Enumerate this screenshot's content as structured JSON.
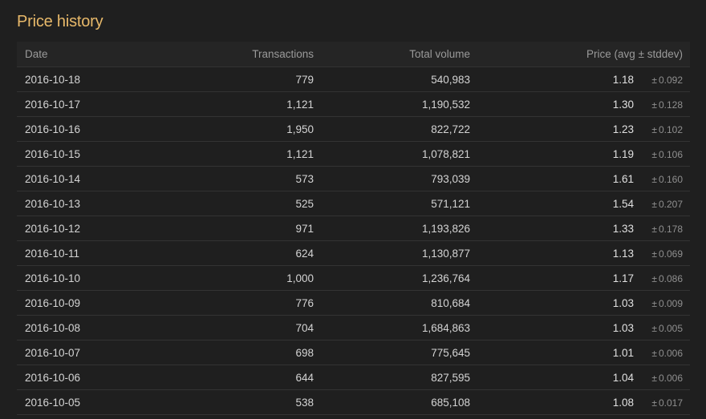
{
  "title": "Price history",
  "columns": {
    "date": "Date",
    "transactions": "Transactions",
    "volume": "Total volume",
    "price": "Price (avg ± stddev)"
  },
  "pm_symbol": "±",
  "colors": {
    "background": "#1f1f1f",
    "title": "#e8b96a",
    "header_text": "#9a9a9a",
    "row_divider": "#333333"
  },
  "rows": [
    {
      "date": "2016-10-18",
      "transactions": "779",
      "volume": "540,983",
      "avg": "1.18",
      "stddev": "0.092"
    },
    {
      "date": "2016-10-17",
      "transactions": "1,121",
      "volume": "1,190,532",
      "avg": "1.30",
      "stddev": "0.128"
    },
    {
      "date": "2016-10-16",
      "transactions": "1,950",
      "volume": "822,722",
      "avg": "1.23",
      "stddev": "0.102"
    },
    {
      "date": "2016-10-15",
      "transactions": "1,121",
      "volume": "1,078,821",
      "avg": "1.19",
      "stddev": "0.106"
    },
    {
      "date": "2016-10-14",
      "transactions": "573",
      "volume": "793,039",
      "avg": "1.61",
      "stddev": "0.160"
    },
    {
      "date": "2016-10-13",
      "transactions": "525",
      "volume": "571,121",
      "avg": "1.54",
      "stddev": "0.207"
    },
    {
      "date": "2016-10-12",
      "transactions": "971",
      "volume": "1,193,826",
      "avg": "1.33",
      "stddev": "0.178"
    },
    {
      "date": "2016-10-11",
      "transactions": "624",
      "volume": "1,130,877",
      "avg": "1.13",
      "stddev": "0.069"
    },
    {
      "date": "2016-10-10",
      "transactions": "1,000",
      "volume": "1,236,764",
      "avg": "1.17",
      "stddev": "0.086"
    },
    {
      "date": "2016-10-09",
      "transactions": "776",
      "volume": "810,684",
      "avg": "1.03",
      "stddev": "0.009"
    },
    {
      "date": "2016-10-08",
      "transactions": "704",
      "volume": "1,684,863",
      "avg": "1.03",
      "stddev": "0.005"
    },
    {
      "date": "2016-10-07",
      "transactions": "698",
      "volume": "775,645",
      "avg": "1.01",
      "stddev": "0.006"
    },
    {
      "date": "2016-10-06",
      "transactions": "644",
      "volume": "827,595",
      "avg": "1.04",
      "stddev": "0.006"
    },
    {
      "date": "2016-10-05",
      "transactions": "538",
      "volume": "685,108",
      "avg": "1.08",
      "stddev": "0.017"
    }
  ]
}
